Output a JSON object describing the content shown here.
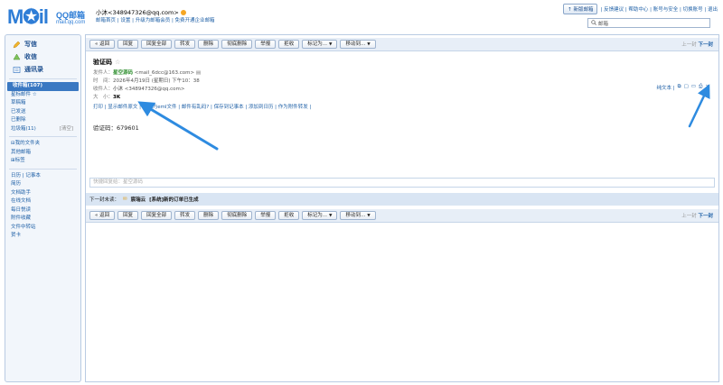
{
  "header": {
    "logo_m": "M✪il",
    "logo_qq": "QQ邮箱",
    "logo_domain": "mail.qq.com",
    "user": "小沐<348947326@qq.com>",
    "links": "邮箱首页 | 设置 | 升级为邮箱会员 | 免费开通企业邮箱",
    "new_version": "↑ 新版邮箱",
    "top_links": "| 反馈建议 | 帮助中心 | 账号与安全 | 切换账号 | 退出",
    "search_placeholder": "邮箱"
  },
  "sidebar": {
    "write": "写信",
    "inbox_big": "收信",
    "contacts": "通讯录",
    "folders": [
      {
        "label": "收件箱(107)",
        "active": true,
        "extra": ""
      },
      {
        "label": "星标邮件 ☆",
        "active": false,
        "extra": ""
      },
      {
        "label": "草稿箱",
        "active": false,
        "extra": ""
      },
      {
        "label": "已发送",
        "active": false,
        "extra": ""
      },
      {
        "label": "已删除",
        "active": false,
        "extra": ""
      },
      {
        "label": "垃圾箱(11)",
        "active": false,
        "extra": "[清空]"
      }
    ],
    "group1": [
      {
        "label": "⊟我的文件夹"
      },
      {
        "label": "其他邮箱"
      },
      {
        "label": "⊞标签"
      }
    ],
    "group2": [
      {
        "label": "日历 | 记事本"
      },
      {
        "label": "简历"
      },
      {
        "label": "文档助手"
      },
      {
        "label": "在线文档"
      },
      {
        "label": "每日悦读"
      },
      {
        "label": "附件收藏"
      },
      {
        "label": "文件中转站"
      },
      {
        "label": "贺卡"
      }
    ]
  },
  "toolbar": {
    "back": "« 返回",
    "reply": "回复",
    "reply_all": "回复全部",
    "forward": "转发",
    "delete": "删除",
    "perm_delete": "彻底删除",
    "report": "举报",
    "reject": "拒收",
    "mark_as": "标记为...",
    "move_to": "移动到...",
    "prev": "上一封",
    "next": "下一封"
  },
  "mail": {
    "subject": "验证码",
    "sender_label": "发件人：",
    "sender_name": "星空源码",
    "sender_addr": "<mail_6dcc@163.com>",
    "time_label": "时　间：",
    "time": "2026年4月19日 (星期日) 下午10：38",
    "to_label": "收件人：",
    "to_name": "小沐",
    "to_addr": "<348947326@qq.com>",
    "size_label": "大　小：",
    "size": "3K",
    "actions": "打印 | 显示邮件原文 | 导出为eml文件 | 邮件有乱码? | 保存到记事本 | 添加到日历 | 作为附件转发 |",
    "plain_text": "纯文本 |",
    "body": "验证码：679601"
  },
  "quick_reply_placeholder": "快捷回复给：星空源码",
  "next_mail": {
    "label": "下一封未读：",
    "sender": "宸瑞云",
    "subject": "[系统]新的订单已生成"
  }
}
